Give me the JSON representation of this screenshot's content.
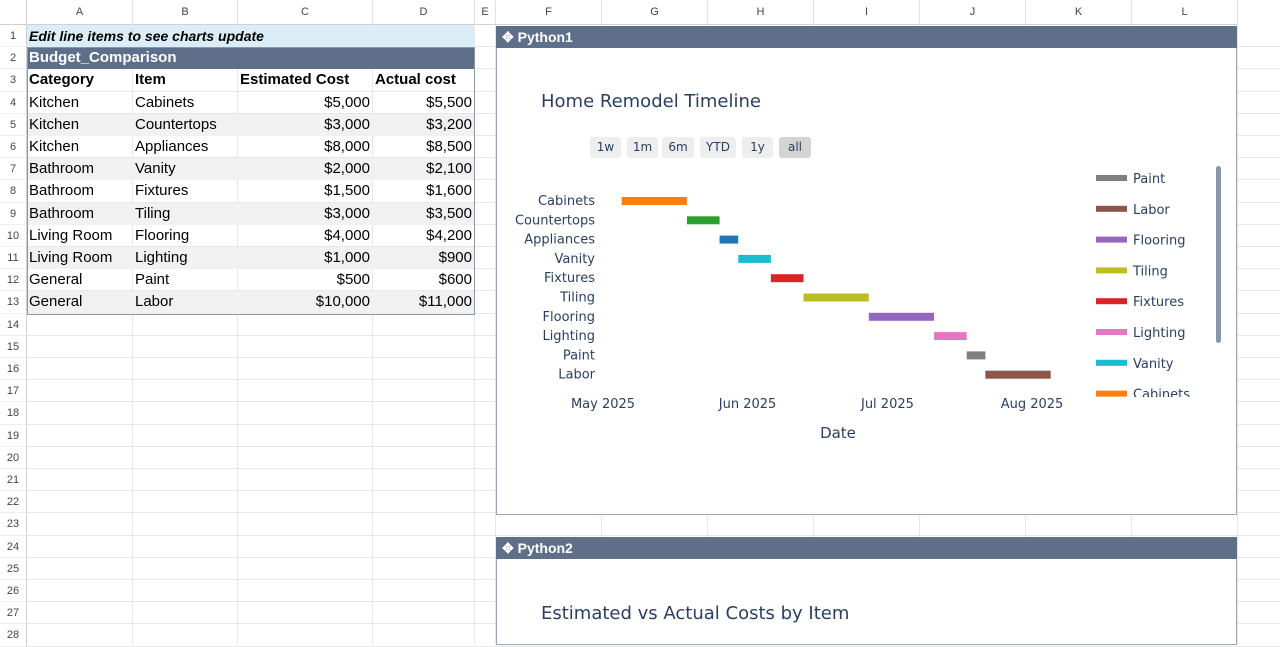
{
  "columns": [
    "A",
    "B",
    "C",
    "D",
    "E",
    "F",
    "G",
    "H",
    "I",
    "J",
    "K",
    "L"
  ],
  "rows": [
    "1",
    "2",
    "3",
    "4",
    "5",
    "6",
    "7",
    "8",
    "9",
    "10",
    "11",
    "12",
    "13",
    "14",
    "15",
    "16",
    "17",
    "18",
    "19",
    "20",
    "21",
    "22",
    "23",
    "24",
    "25",
    "26",
    "27",
    "28"
  ],
  "note": "Edit line items to see charts update",
  "table": {
    "name": "Budget_Comparison",
    "headers": [
      "Category",
      "Item",
      "Estimated Cost",
      "Actual cost"
    ],
    "rows": [
      [
        "Kitchen",
        "Cabinets",
        "$5,000",
        "$5,500"
      ],
      [
        "Kitchen",
        "Countertops",
        "$3,000",
        "$3,200"
      ],
      [
        "Kitchen",
        "Appliances",
        "$8,000",
        "$8,500"
      ],
      [
        "Bathroom",
        "Vanity",
        "$2,000",
        "$2,100"
      ],
      [
        "Bathroom",
        "Fixtures",
        "$1,500",
        "$1,600"
      ],
      [
        "Bathroom",
        "Tiling",
        "$3,000",
        "$3,500"
      ],
      [
        "Living Room",
        "Flooring",
        "$4,000",
        "$4,200"
      ],
      [
        "Living Room",
        "Lighting",
        "$1,000",
        "$900"
      ],
      [
        "General",
        "Paint",
        "$500",
        "$600"
      ],
      [
        "General",
        "Labor",
        "$10,000",
        "$11,000"
      ]
    ]
  },
  "panels": {
    "python1": {
      "title": "✥ Python1"
    },
    "python2": {
      "title": "✥ Python2",
      "chart_title": "Estimated vs Actual Costs by Item"
    }
  },
  "chart_data": {
    "type": "timeline",
    "title": "Home Remodel Timeline",
    "xlabel": "Date",
    "ylabel": "",
    "x_ticks": [
      "May 2025",
      "Jun 2025",
      "Jul 2025",
      "Aug 2025"
    ],
    "range_buttons": [
      "1w",
      "1m",
      "6m",
      "YTD",
      "1y",
      "all"
    ],
    "active_range": "all",
    "tasks": [
      {
        "item": "Cabinets",
        "start": "2025-05-05",
        "end": "2025-05-19",
        "color": "#ff7f0e"
      },
      {
        "item": "Countertops",
        "start": "2025-05-19",
        "end": "2025-05-26",
        "color": "#2ca02c"
      },
      {
        "item": "Appliances",
        "start": "2025-05-26",
        "end": "2025-05-30",
        "color": "#1f77b4"
      },
      {
        "item": "Vanity",
        "start": "2025-05-30",
        "end": "2025-06-06",
        "color": "#17becf"
      },
      {
        "item": "Fixtures",
        "start": "2025-06-06",
        "end": "2025-06-13",
        "color": "#d62728"
      },
      {
        "item": "Tiling",
        "start": "2025-06-13",
        "end": "2025-06-27",
        "color": "#bcbd22"
      },
      {
        "item": "Flooring",
        "start": "2025-06-27",
        "end": "2025-07-11",
        "color": "#9467bd"
      },
      {
        "item": "Lighting",
        "start": "2025-07-11",
        "end": "2025-07-18",
        "color": "#e377c2"
      },
      {
        "item": "Paint",
        "start": "2025-07-18",
        "end": "2025-07-22",
        "color": "#7f7f7f"
      },
      {
        "item": "Labor",
        "start": "2025-07-22",
        "end": "2025-08-05",
        "color": "#8c564b"
      }
    ],
    "legend": [
      "Paint",
      "Labor",
      "Flooring",
      "Tiling",
      "Fixtures",
      "Lighting",
      "Vanity",
      "Cabinets"
    ],
    "legend_position": "right",
    "grid": false
  }
}
